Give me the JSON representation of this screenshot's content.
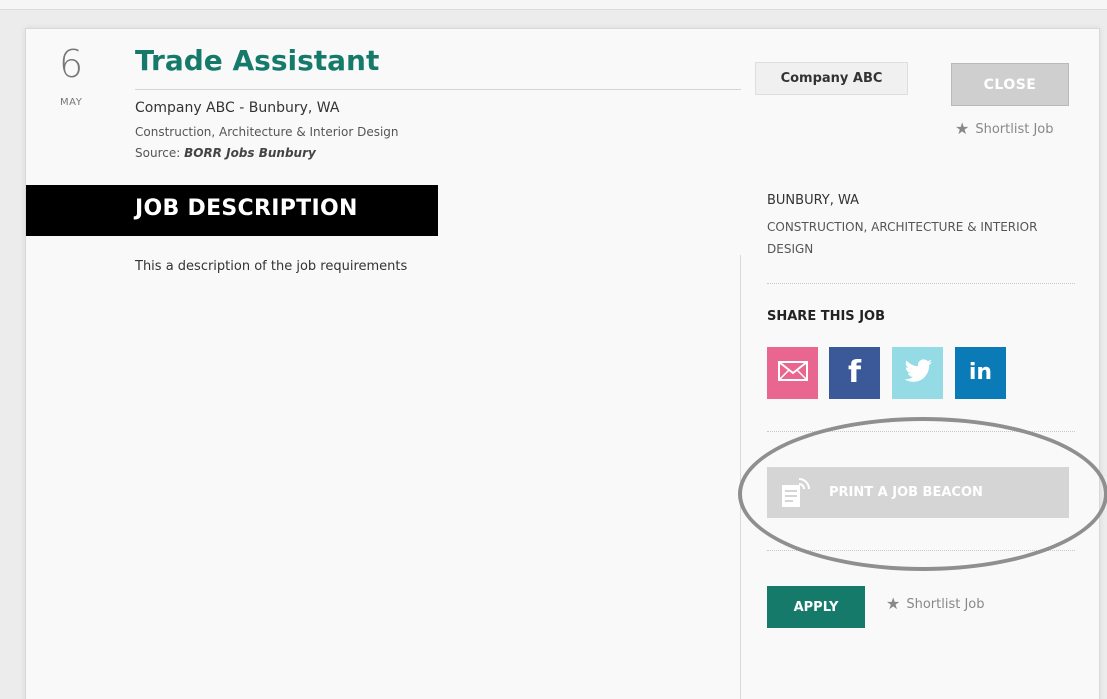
{
  "job": {
    "day": "6",
    "month": "MAY",
    "title": "Trade Assistant",
    "company_location": "Company ABC - Bunbury, WA",
    "category": "Construction, Architecture & Interior Design",
    "source_label": "Source:",
    "source_name": "BORR Jobs Bunbury"
  },
  "description": {
    "heading": "JOB DESCRIPTION",
    "text": "This a description of the job requirements"
  },
  "sidebar": {
    "company_badge": "Company ABC",
    "close_label": "CLOSE",
    "shortlist_label": "Shortlist Job",
    "location_upper": "BUNBURY, WA",
    "category_upper": "CONSTRUCTION, ARCHITECTURE & INTERIOR DESIGN",
    "share_title": "SHARE THIS JOB",
    "share_icons": [
      "email-icon",
      "facebook-icon",
      "twitter-icon",
      "linkedin-icon"
    ],
    "beacon_label": "PRINT A JOB BEACON",
    "apply_label": "APPLY",
    "shortlist_bottom_label": "Shortlist Job"
  },
  "colors": {
    "brand_green": "#167a6a",
    "email": "#e8668f",
    "facebook": "#3b5998",
    "twitter": "#94dbe6",
    "linkedin": "#0b7bb8"
  }
}
